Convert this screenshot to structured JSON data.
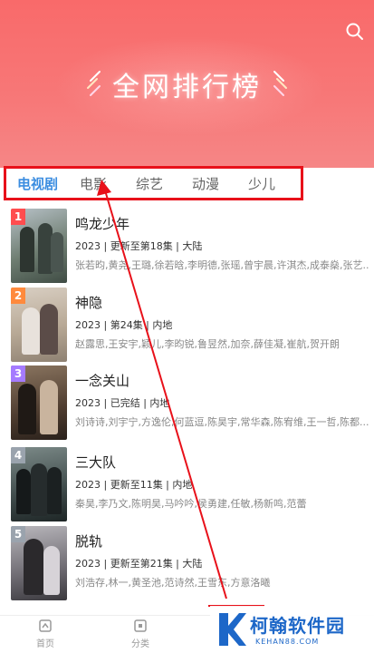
{
  "header": {
    "title": "全网排行榜",
    "icons": {
      "search": "search-icon",
      "deco": "sparkle-icon"
    }
  },
  "tabs": [
    {
      "label": "电视剧",
      "active": true
    },
    {
      "label": "电影",
      "active": false
    },
    {
      "label": "综艺",
      "active": false
    },
    {
      "label": "动漫",
      "active": false
    },
    {
      "label": "少儿",
      "active": false
    }
  ],
  "items": [
    {
      "rank": "1",
      "name": "鸣龙少年",
      "meta": "2023 | 更新至第18集 | 大陆",
      "cast": "张若昀,黄尧,王璐,徐若晗,李明德,张瑶,曾宇晨,许淇杰,成泰燊,张艺...",
      "rank_color": "#ff4d4f"
    },
    {
      "rank": "2",
      "name": "神隐",
      "meta": "2023 | 第24集 | 内地",
      "cast": "赵露思,王安宇,颖儿,李昀锐,鲁昱然,加奈,薛佳凝,崔航,贺开朗",
      "rank_color": "#ff8a3d"
    },
    {
      "rank": "3",
      "name": "一念关山",
      "meta": "2023 | 已完结 | 内地",
      "cast": "刘诗诗,刘宇宁,方逸伦,何蓝逗,陈昊宇,常华森,陈宥维,王一哲,陈都...",
      "rank_color": "#a57bff"
    },
    {
      "rank": "4",
      "name": "三大队",
      "meta": "2023 | 更新至11集 | 内地",
      "cast": "秦昊,李乃文,陈明昊,马吟吟,侯勇建,任敏,杨新鸣,范蕾",
      "rank_color": "#9aa3ad"
    },
    {
      "rank": "5",
      "name": "脱轨",
      "meta": "2023 | 更新至第21集 | 大陆",
      "cast": "刘浩存,林一,黄圣池,范诗然,王雪东,方意洛曦",
      "rank_color": "#9aa3ad"
    }
  ],
  "tabbar": [
    {
      "label": "首页",
      "icon": "home-icon"
    },
    {
      "label": "分类",
      "icon": "category-icon"
    }
  ],
  "watermark": {
    "name": "柯翰软件园",
    "url": "KEHAN88.COM"
  },
  "colors": {
    "accent": "#3b8de0",
    "header": "#f77878",
    "highlight": "#e8111a"
  }
}
